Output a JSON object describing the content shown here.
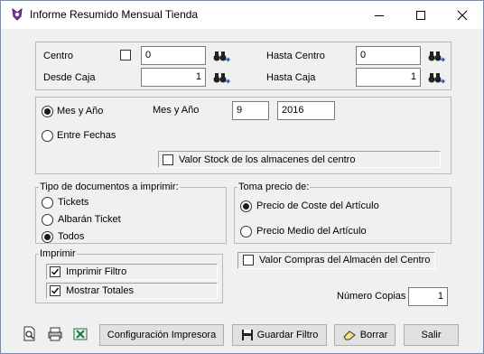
{
  "window": {
    "title": "Informe Resumido Mensual Tienda"
  },
  "top": {
    "centro_label": "Centro",
    "centro_value": "0",
    "hasta_centro_label": "Hasta Centro",
    "hasta_centro_value": "0",
    "desde_caja_label": "Desde Caja",
    "desde_caja_value": "1",
    "hasta_caja_label": "Hasta Caja",
    "hasta_caja_value": "1"
  },
  "period": {
    "mes_ano_option": "Mes y Año",
    "entre_fechas_option": "Entre Fechas",
    "mes_ano_label": "Mes y Año",
    "month_value": "9",
    "year_value": "2016",
    "stock_label": "Valor Stock de los almacenes del centro"
  },
  "doc_types": {
    "title": "Tipo de documentos a imprimir:",
    "options": [
      "Tickets",
      "Albarán Ticket",
      "Todos"
    ],
    "selected": "Todos"
  },
  "price": {
    "title": "Toma precio de:",
    "options": [
      "Precio de Coste del Artículo",
      "Precio Medio del Artículo"
    ],
    "selected": "Precio de Coste del Artículo"
  },
  "print": {
    "title": "Imprimir",
    "filtro_label": "Imprimir Filtro",
    "totales_label": "Mostrar Totales"
  },
  "compras_label": "Valor Compras del Almacén del Centro",
  "copias": {
    "label": "Número Copias",
    "value": "1"
  },
  "buttons": {
    "config": "Configuración Impresora",
    "guardar": "Guardar Filtro",
    "borrar": "Borrar",
    "salir": "Salir"
  }
}
